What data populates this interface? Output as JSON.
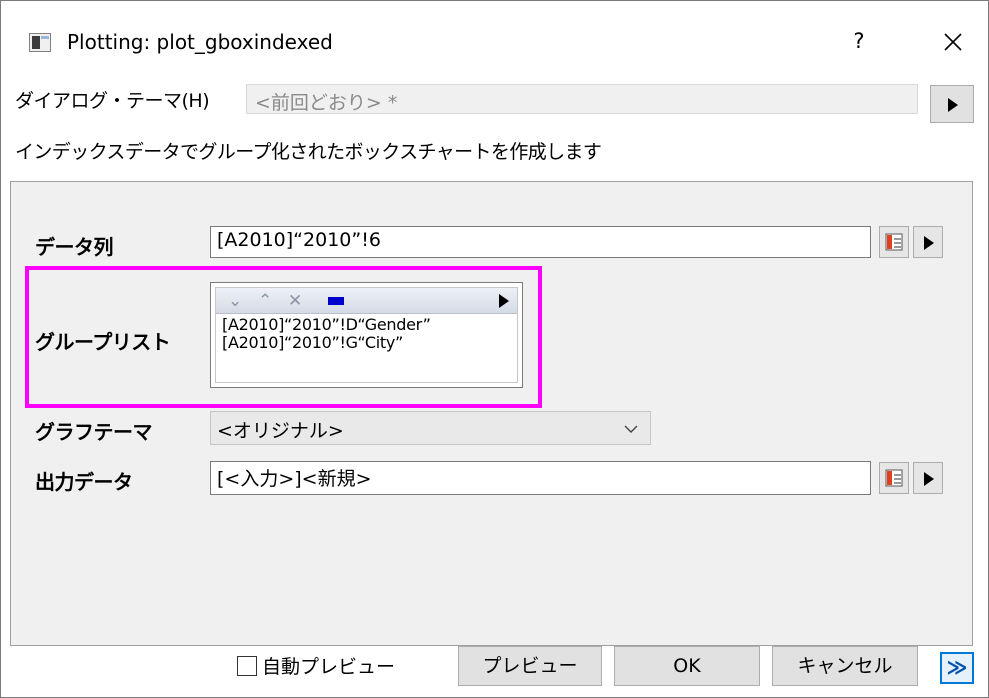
{
  "window": {
    "title": "Plotting: plot_gboxindexed",
    "help_label": "?"
  },
  "theme": {
    "label": "ダイアログ・テーマ(H)",
    "value": "<前回どおり> *"
  },
  "description": "インデックスデータでグループ化されたボックスチャートを作成します",
  "fields": {
    "data_column": {
      "label": "データ列",
      "value": "[A2010]“2010”!6"
    },
    "group_list": {
      "label": "グループリスト",
      "items": [
        "[A2010]“2010”!D“Gender”",
        "[A2010]“2010”!G“City”"
      ]
    },
    "graph_theme": {
      "label": "グラフテーマ",
      "value": "<オリジナル>"
    },
    "output_data": {
      "label": "出力データ",
      "value": "[<入力>]<新規>"
    }
  },
  "footer": {
    "auto_preview_label": "自動プレビュー",
    "preview_label": "プレビュー",
    "ok_label": "OK",
    "cancel_label": "キャンセル",
    "expand_label": "≫"
  },
  "colors": {
    "highlight": "#ff00ff",
    "accent": "#0078d7"
  }
}
